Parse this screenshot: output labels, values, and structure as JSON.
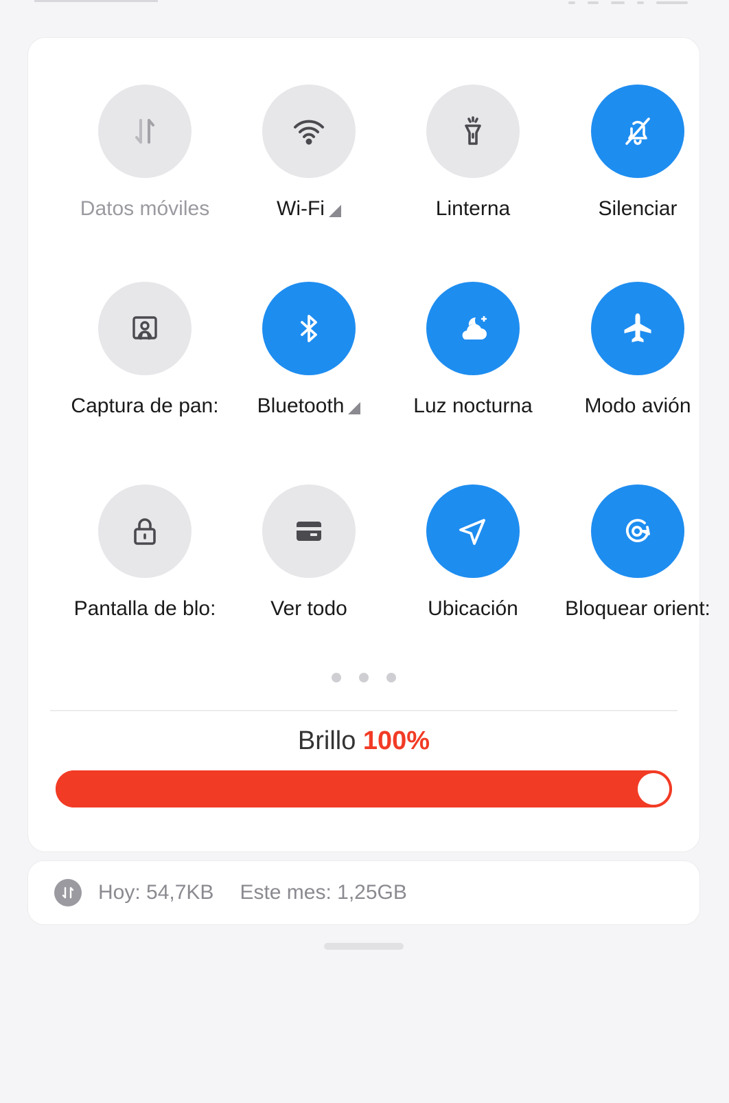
{
  "tiles": [
    {
      "label": "Datos móviles",
      "icon": "mobile-data-icon",
      "active": false,
      "dim": true,
      "expand": false
    },
    {
      "label": "Wi-Fi",
      "icon": "wifi-icon",
      "active": false,
      "dim": false,
      "expand": true
    },
    {
      "label": "Linterna",
      "icon": "flashlight-icon",
      "active": false,
      "dim": false,
      "expand": false
    },
    {
      "label": "Silenciar",
      "icon": "bell-off-icon",
      "active": true,
      "dim": false,
      "expand": false
    },
    {
      "label": "Captura de pan:",
      "icon": "screenshot-icon",
      "active": false,
      "dim": false,
      "expand": false
    },
    {
      "label": "Bluetooth",
      "icon": "bluetooth-icon",
      "active": true,
      "dim": false,
      "expand": true
    },
    {
      "label": "Luz nocturna",
      "icon": "night-light-icon",
      "active": true,
      "dim": false,
      "expand": false
    },
    {
      "label": "Modo avión",
      "icon": "airplane-icon",
      "active": true,
      "dim": false,
      "expand": false
    },
    {
      "label": "Pantalla de blo:",
      "icon": "lock-icon",
      "active": false,
      "dim": false,
      "expand": false
    },
    {
      "label": "Ver todo",
      "icon": "wallet-icon",
      "active": false,
      "dim": false,
      "expand": false
    },
    {
      "label": "Ubicación",
      "icon": "location-arrow-icon",
      "active": true,
      "dim": false,
      "expand": false
    },
    {
      "label": "Bloquear orient:",
      "icon": "rotation-lock-icon",
      "active": true,
      "dim": false,
      "expand": false
    }
  ],
  "page_dots": 3,
  "brightness": {
    "label": "Brillo",
    "value_text": "100%",
    "level": 1.0
  },
  "data_usage": {
    "icon": "data-usage-icon",
    "today": "Hoy: 54,7KB",
    "month": "Este mes: 1,25GB"
  },
  "colors": {
    "active": "#1e8df0",
    "inactive": "#e7e7ea",
    "brightness": "#f23b25"
  }
}
